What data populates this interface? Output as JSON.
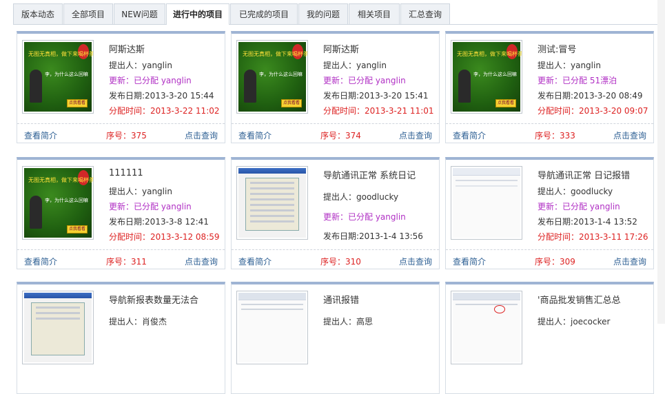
{
  "tabs": [
    "版本动态",
    "全部项目",
    "NEW问题",
    "进行中的项目",
    "已完成的项目",
    "我的问题",
    "相关项目",
    "汇总查询"
  ],
  "active_tab": "进行中的项目",
  "labels": {
    "view_intro": "查看简介",
    "query": "点击查询"
  },
  "cards": [
    {
      "title": "阿斯达斯",
      "proposer": "提出人：yanglin",
      "update": "更新：已分配 yanglin",
      "publish": "发布日期:2013-3-20 15:44",
      "assign": "分配时间：2013-3-22 11:02",
      "serial": "序号：375",
      "thumb": "promo-ad"
    },
    {
      "title": "阿斯达斯",
      "proposer": "提出人：yanglin",
      "update": "更新：已分配 yanglin",
      "publish": "发布日期:2013-3-20 15:41",
      "assign": "分配时间：2013-3-21 11:01",
      "serial": "序号：374",
      "thumb": "promo-ad"
    },
    {
      "title": "测试:冒号",
      "proposer": "提出人：yanglin",
      "update": "更新：已分配 51漂泊",
      "publish": "发布日期:2013-3-20 08:49",
      "assign": "分配时间：2013-3-20 09:07",
      "serial": "序号：333",
      "thumb": "promo-ad"
    },
    {
      "title": "111111",
      "proposer": "提出人：yanglin",
      "update": "更新：已分配 yanglin",
      "publish": "发布日期:2013-3-8 12:41",
      "assign": "分配时间：2013-3-12 08:59",
      "serial": "序号：311",
      "thumb": "promo-ad"
    },
    {
      "title": "导航通讯正常 系统日记",
      "proposer": "提出人：goodlucky",
      "update": "更新：已分配 yanglin",
      "publish": "发布日期:2013-1-4 13:56",
      "assign": "",
      "serial": "序号：310",
      "thumb": "window-shot"
    },
    {
      "title": "导航通讯正常 日记报错",
      "proposer": "提出人：goodlucky",
      "update": "更新：已分配 yanglin",
      "publish": "发布日期:2013-1-4 13:52",
      "assign": "分配时间：2013-3-11 17:26",
      "serial": "序号：309",
      "thumb": "table-shot"
    },
    {
      "title": "导航新报表数量无法合",
      "proposer": "提出人：肖俊杰",
      "update": "",
      "publish": "",
      "assign": "",
      "serial": "",
      "thumb": "window-shot"
    },
    {
      "title": "通讯报错",
      "proposer": "提出人：高思",
      "update": "",
      "publish": "",
      "assign": "",
      "serial": "",
      "thumb": "table-shot"
    },
    {
      "title": "'商品批发销售汇总总",
      "proposer": "提出人：joecocker",
      "update": "",
      "publish": "",
      "assign": "",
      "serial": "",
      "thumb": "table-shot"
    }
  ],
  "ad_text": {
    "line1": "无图无真相，做下来喝杯茶吧",
    "line2": "李，为什么这么回嘛",
    "button": "点我看看"
  }
}
